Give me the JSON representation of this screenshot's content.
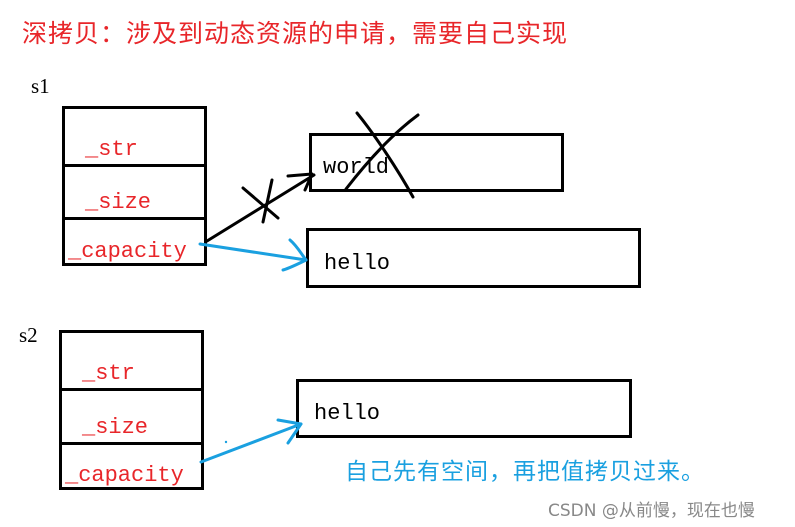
{
  "title": "深拷贝：涉及到动态资源的申请，需要自己实现",
  "objects": [
    {
      "name": "s1",
      "fields": [
        "_str",
        "_size",
        "_capacity"
      ]
    },
    {
      "name": "s2",
      "fields": [
        "_str",
        "_size",
        "_capacity"
      ]
    }
  ],
  "heap_blocks": [
    {
      "id": "world-block",
      "value": "world",
      "crossed_out": true
    },
    {
      "id": "s1-hello-block",
      "value": "hello",
      "crossed_out": false
    },
    {
      "id": "s2-hello-block",
      "value": "hello",
      "crossed_out": false
    }
  ],
  "arrows": [
    {
      "from": "s1._capacity",
      "to": "world",
      "color": "#000000",
      "crossed_out": true
    },
    {
      "from": "s1._capacity",
      "to": "hello",
      "color": "#1aa0e0",
      "crossed_out": false
    },
    {
      "from": "s2._capacity",
      "to": "hello",
      "color": "#1aa0e0",
      "crossed_out": false
    }
  ],
  "note": "自己先有空间，再把值拷贝过来。",
  "watermark": "CSDN @从前慢，现在也慢",
  "colors": {
    "field_text": "#e8262a",
    "title": "#e8262a",
    "note": "#1aa0e0",
    "blue_arrow": "#1aa0e0",
    "black": "#000000"
  }
}
